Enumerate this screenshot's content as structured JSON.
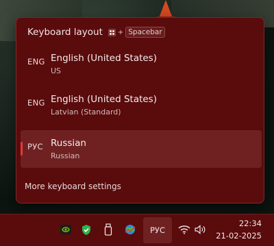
{
  "flyout": {
    "title": "Keyboard layout",
    "shortcut_plus": "+",
    "shortcut_key": "Spacebar",
    "layouts": [
      {
        "code": "ENG",
        "name": "English (United States)",
        "sub": "US",
        "selected": false
      },
      {
        "code": "ENG",
        "name": "English (United States)",
        "sub": "Latvian (Standard)",
        "selected": false
      },
      {
        "code": "РУС",
        "name": "Russian",
        "sub": "Russian",
        "selected": true
      }
    ],
    "more_settings": "More keyboard settings"
  },
  "taskbar": {
    "ime_label": "РУС",
    "time": "22:34",
    "date": "21-02-2025",
    "tray_icons": [
      "nvidia-icon",
      "shield-check-icon",
      "usb-drive-icon",
      "network-globe-icon"
    ],
    "system_icons": [
      "wifi-icon",
      "speaker-icon"
    ]
  },
  "colors": {
    "accent": "#e03a3c",
    "flyout_bg": "#5a0b0c",
    "selected_bg": "#6f2122"
  }
}
